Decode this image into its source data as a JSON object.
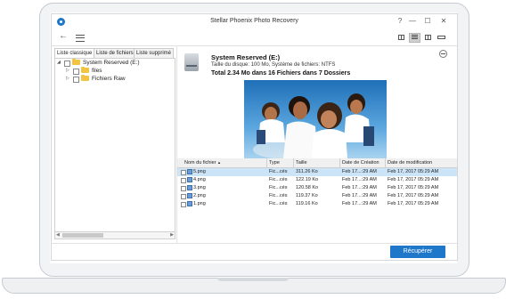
{
  "window": {
    "title": "Stellar Phoenix Photo Recovery"
  },
  "window_controls": {
    "help": "?",
    "minimize": "—",
    "maximize": "☐",
    "close": "✕"
  },
  "toolbar": {
    "back": "←"
  },
  "left_panel": {
    "tabs": [
      "Liste classique",
      "Liste de fichiers",
      "Liste supprimé"
    ],
    "tree": [
      {
        "label": "System Reserved (E:)",
        "expanded": true,
        "level": 0
      },
      {
        "label": "files",
        "expanded": false,
        "level": 1
      },
      {
        "label": "Fichiers Raw",
        "expanded": false,
        "level": 1
      }
    ],
    "tree_arrows": {
      "expanded": "◢",
      "collapsed": "▷"
    }
  },
  "drive_info": {
    "name": "System Reserved (E:)",
    "details": "Taille du disque: 100 Mo, Système de fichiers: NTFS",
    "total": "Total 2.34 Mo dans 16 Fichiers dans 7 Dossiers"
  },
  "file_table": {
    "columns": [
      "Nom du fichier",
      "Type",
      "Taille",
      "Date de Création",
      "Date de modification"
    ],
    "rows": [
      {
        "name": "5.png",
        "type": "Fic...cés",
        "size": "311.26 Ko",
        "created": "Feb 17...:29 AM",
        "modified": "Feb 17, 2017 05:29 AM",
        "selected": true
      },
      {
        "name": "4.png",
        "type": "Fic...cés",
        "size": "122.19 Ko",
        "created": "Feb 17...:29 AM",
        "modified": "Feb 17, 2017 05:29 AM",
        "selected": false
      },
      {
        "name": "3.png",
        "type": "Fic...cés",
        "size": "120.58 Ko",
        "created": "Feb 17...:29 AM",
        "modified": "Feb 17, 2017 05:29 AM",
        "selected": false
      },
      {
        "name": "2.png",
        "type": "Fic...cés",
        "size": "119.37 Ko",
        "created": "Feb 17...:29 AM",
        "modified": "Feb 17, 2017 05:29 AM",
        "selected": false
      },
      {
        "name": "1.png",
        "type": "Fic...cés",
        "size": "119.16 Ko",
        "created": "Feb 17...:29 AM",
        "modified": "Feb 17, 2017 05:29 AM",
        "selected": false
      }
    ]
  },
  "footer": {
    "recover_label": "Récupérer"
  },
  "colors": {
    "accent": "#1e77c8",
    "selection": "#cce4f7",
    "folder": "#f3c442"
  }
}
